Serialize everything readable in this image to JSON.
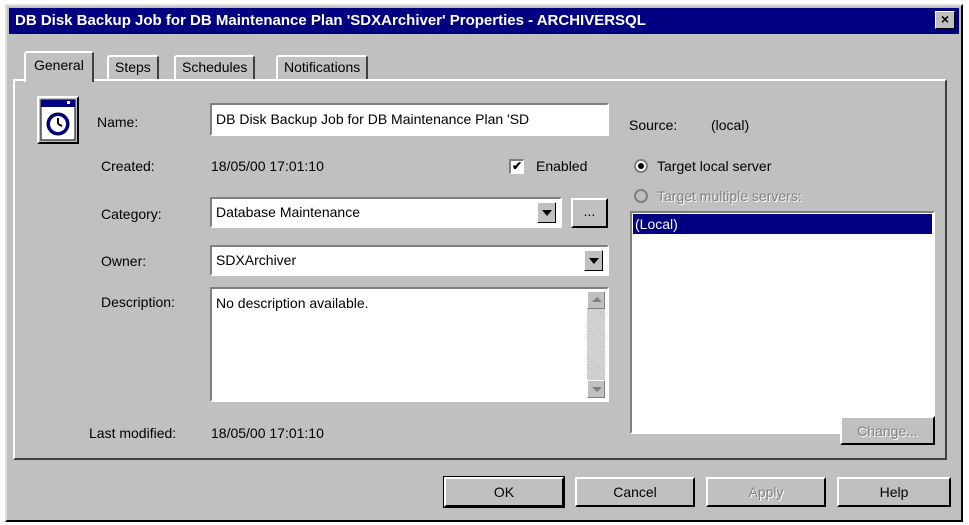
{
  "window": {
    "title": "DB Disk Backup Job for DB Maintenance Plan 'SDXArchiver' Properties - ARCHIVERSQL",
    "close_glyph": "×"
  },
  "tabs": [
    {
      "label": "General",
      "active": true
    },
    {
      "label": "Steps",
      "active": false
    },
    {
      "label": "Schedules",
      "active": false
    },
    {
      "label": "Notifications",
      "active": false
    }
  ],
  "general": {
    "icon": "job-icon",
    "name_label": "Name:",
    "name_value": "DB Disk Backup Job for DB Maintenance Plan 'SD",
    "source_label": "Source:",
    "source_value": "(local)",
    "created_label": "Created:",
    "created_value": "18/05/00 17:01:10",
    "enabled_label": "Enabled",
    "enabled_checked": true,
    "category_label": "Category:",
    "category_value": "Database Maintenance",
    "browse_label": "...",
    "owner_label": "Owner:",
    "owner_value": "SDXArchiver",
    "description_label": "Description:",
    "description_value": "No description available.",
    "last_modified_label": "Last modified:",
    "last_modified_value": "18/05/00 17:01:10",
    "target_local_label": "Target local server",
    "target_multiple_label": "Target multiple servers:",
    "target_selected": "local",
    "servers": [
      "(Local)"
    ],
    "change_label": "Change..."
  },
  "buttons": {
    "ok": "OK",
    "cancel": "Cancel",
    "apply": "Apply",
    "help": "Help"
  }
}
